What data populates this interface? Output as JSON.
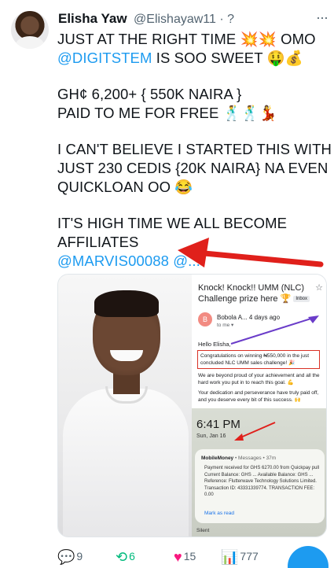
{
  "tweet": {
    "author_name": "Elisha Yaw",
    "author_handle": "@Elishayaw11 · ?",
    "more_label": "···",
    "lines": {
      "l1_text": "JUST  AT THE RIGHT TIME 💥💥 OMO",
      "l2_mention": "@DIGITSTEM",
      "l2_text": " IS  SOO SWEET 🤑💰",
      "l3": "GH¢ 6,200+ { 550K NAIRA }",
      "l4": "PAID TO ME FOR FREE 🕺🕺💃",
      "l5": "I CAN'T BELIEVE I STARTED THIS WITH",
      "l6": "JUST 230 CEDIS {20K NAIRA} NA EVEN",
      "l7": "QUICKLOAN OO 😂",
      "l8": " IT'S HIGH TIME WE ALL BECOME",
      "l9": "AFFILIATES",
      "l10_mention": "@MARVIS00088 @..."
    }
  },
  "media": {
    "email": {
      "subject": "Knock! Knock!! UMM (NLC) Challenge prize here 🏆",
      "inbox_tag": "Inbox",
      "sender_initial": "B",
      "sender_name": "Bobola A... 4 days ago",
      "sender_to": "to me ▾",
      "greeting": "Hello Elisha,",
      "highlight": "Congratulations on winning ₦550,000 in the just concluded NLC UMM sales challenge! 🎉",
      "para1": "We are beyond proud of your achievement and all the hard work you put in to reach this goal. 💪",
      "para2": "Your dedication and perseverance have truly paid off, and you deserve every bit of this success. 🙌"
    },
    "lock_screen": {
      "time": "6:41 PM",
      "date": "Sun, Jan 16",
      "notif_app": "MobileMoney",
      "notif_meta": " • Messages • 37m",
      "notif_text": "Payment received for GHS 6270.00 from Quickpay pull Current Balance: GHS ... Available Balance: GHS ... Reference: Flutterwave Technology Solutions Limited. Transaction ID: 43331339774. TRANSACTION FEE: 0.00",
      "notif_action": "Mark as read",
      "silent_label": "Silent"
    }
  },
  "actions": {
    "replies": "9",
    "retweets": "6",
    "likes": "15",
    "views": "777"
  },
  "colors": {
    "mention": "#1d9bf0",
    "retweet": "#00ba7c",
    "like": "#f91880",
    "highlight_border": "#d93025",
    "arrow": "#e0201b"
  }
}
